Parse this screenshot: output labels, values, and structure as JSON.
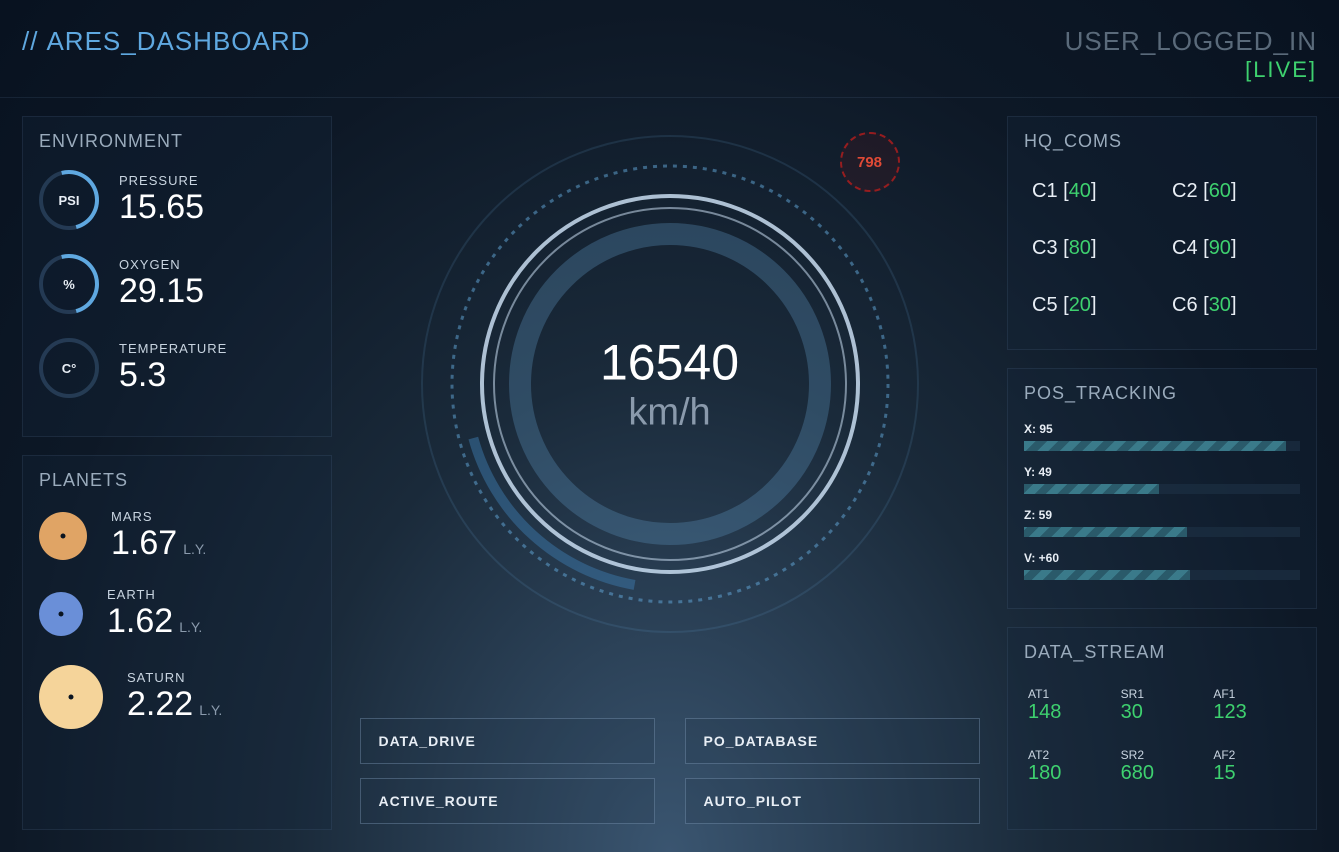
{
  "header": {
    "slashes": "//",
    "title": "ARES_DASHBOARD",
    "user": "USER_LOGGED_IN",
    "live": "[LIVE]"
  },
  "environment": {
    "title": "ENVIRONMENT",
    "items": [
      {
        "unit": "PSI",
        "label": "PRESSURE",
        "value": "15.65"
      },
      {
        "unit": "%",
        "label": "OXYGEN",
        "value": "29.15"
      },
      {
        "unit": "C°",
        "label": "TEMPERATURE",
        "value": "5.3"
      }
    ]
  },
  "planets": {
    "title": "PLANETS",
    "unit": "L.Y.",
    "items": [
      {
        "label": "MARS",
        "value": "1.67",
        "color": "#e0a465",
        "size": 48
      },
      {
        "label": "EARTH",
        "value": "1.62",
        "color": "#6a8fd8",
        "size": 44
      },
      {
        "label": "SATURN",
        "value": "2.22",
        "color": "#f5d49a",
        "size": 64
      }
    ]
  },
  "gauge": {
    "speed": "16540",
    "unit": "km/h",
    "badge": "798"
  },
  "buttons": [
    "DATA_DRIVE",
    "PO_DATABASE",
    "ACTIVE_ROUTE",
    "AUTO_PILOT"
  ],
  "coms": {
    "title": "HQ_COMS",
    "items": [
      {
        "label": "C1",
        "value": "40"
      },
      {
        "label": "C2",
        "value": "60"
      },
      {
        "label": "C3",
        "value": "80"
      },
      {
        "label": "C4",
        "value": "90"
      },
      {
        "label": "C5",
        "value": "20"
      },
      {
        "label": "C6",
        "value": "30"
      }
    ]
  },
  "tracking": {
    "title": "POS_TRACKING",
    "items": [
      {
        "label": "X: 95",
        "pct": 95
      },
      {
        "label": "Y: 49",
        "pct": 49
      },
      {
        "label": "Z: 59",
        "pct": 59
      },
      {
        "label": "V: +60",
        "pct": 60
      }
    ]
  },
  "datastream": {
    "title": "DATA_STREAM",
    "items": [
      {
        "label": "AT1",
        "value": "148"
      },
      {
        "label": "SR1",
        "value": "30"
      },
      {
        "label": "AF1",
        "value": "123"
      },
      {
        "label": "AT2",
        "value": "180"
      },
      {
        "label": "SR2",
        "value": "680"
      },
      {
        "label": "AF2",
        "value": "15"
      }
    ]
  }
}
